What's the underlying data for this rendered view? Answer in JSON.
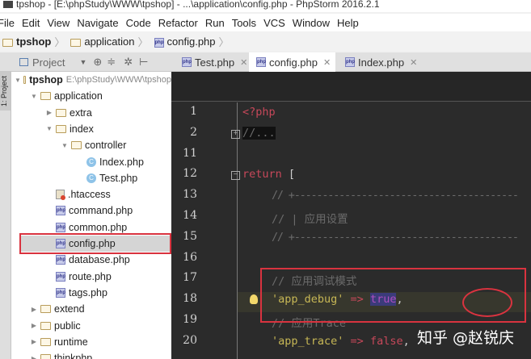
{
  "title": "tpshop - [E:\\phpStudy\\WWW\\tpshop] - ...\\application\\config.php - PhpStorm 2016.2.1",
  "menu": [
    "File",
    "Edit",
    "View",
    "Navigate",
    "Code",
    "Refactor",
    "Run",
    "Tools",
    "VCS",
    "Window",
    "Help"
  ],
  "breadcrumb": [
    "tpshop",
    "application",
    "config.php"
  ],
  "project_panel": {
    "label": "Project",
    "strip_label": "1: Project"
  },
  "tabs": [
    {
      "label": "Test.php"
    },
    {
      "label": "config.php",
      "active": true
    },
    {
      "label": "Index.php"
    }
  ],
  "tree": [
    {
      "label": "tpshop",
      "path": "E:\\phpStudy\\WWW\\tpshop",
      "icon": "folder",
      "depth": 0,
      "expanded": true
    },
    {
      "label": "application",
      "icon": "folder",
      "depth": 1,
      "expanded": true
    },
    {
      "label": "extra",
      "icon": "folder",
      "depth": 2,
      "expanded": false
    },
    {
      "label": "index",
      "icon": "folder",
      "depth": 2,
      "expanded": true
    },
    {
      "label": "controller",
      "icon": "folder",
      "depth": 3,
      "expanded": true
    },
    {
      "label": "Index.php",
      "icon": "class",
      "depth": 4
    },
    {
      "label": "Test.php",
      "icon": "class",
      "depth": 4
    },
    {
      "label": ".htaccess",
      "icon": "htaccess",
      "depth": 2
    },
    {
      "label": "command.php",
      "icon": "php",
      "depth": 2
    },
    {
      "label": "common.php",
      "icon": "php",
      "depth": 2
    },
    {
      "label": "config.php",
      "icon": "php",
      "depth": 2,
      "selected": true
    },
    {
      "label": "database.php",
      "icon": "php",
      "depth": 2
    },
    {
      "label": "route.php",
      "icon": "php",
      "depth": 2
    },
    {
      "label": "tags.php",
      "icon": "php",
      "depth": 2
    },
    {
      "label": "extend",
      "icon": "folder",
      "depth": 1,
      "expanded": false
    },
    {
      "label": "public",
      "icon": "folder",
      "depth": 1,
      "expanded": false
    },
    {
      "label": "runtime",
      "icon": "folder",
      "depth": 1,
      "expanded": false
    },
    {
      "label": "thinkphp",
      "icon": "folder",
      "depth": 1,
      "expanded": false
    }
  ],
  "code": [
    {
      "n": "1",
      "parts": [
        [
          "kw",
          "<?php"
        ]
      ]
    },
    {
      "n": "2",
      "parts": [
        [
          "cm",
          "//..."
        ]
      ],
      "fold": "plus"
    },
    {
      "n": "11",
      "parts": []
    },
    {
      "n": "12",
      "parts": [
        [
          "kw",
          "return"
        ],
        [
          "",
          "  ["
        ]
      ],
      "fold": "minus"
    },
    {
      "n": "13",
      "parts": [
        [
          "cm",
          "// +----------------------------------------"
        ]
      ],
      "indent": true
    },
    {
      "n": "14",
      "parts": [
        [
          "cm",
          "// | 应用设置"
        ]
      ],
      "indent": true
    },
    {
      "n": "15",
      "parts": [
        [
          "cm",
          "// +----------------------------------------"
        ]
      ],
      "indent": true
    },
    {
      "n": "16",
      "parts": []
    },
    {
      "n": "17",
      "parts": [
        [
          "cm",
          "// 应用调试模式"
        ]
      ],
      "indent": true
    },
    {
      "n": "18",
      "parts": [
        [
          "str",
          "'app_debug'"
        ],
        [
          "",
          "             "
        ],
        [
          "op",
          "=>"
        ],
        [
          "",
          " "
        ],
        [
          "tr",
          "true"
        ],
        [
          "",
          ","
        ]
      ],
      "indent": true
    },
    {
      "n": "19",
      "parts": [
        [
          "cm",
          "// 应用Trace"
        ]
      ],
      "indent": true
    },
    {
      "n": "20",
      "parts": [
        [
          "str",
          "'app_trace'"
        ],
        [
          "",
          "             "
        ],
        [
          "op",
          "=>"
        ],
        [
          "",
          " "
        ],
        [
          "kw",
          "false"
        ],
        [
          "",
          ","
        ]
      ],
      "indent": true
    }
  ],
  "watermark": "知乎 @赵锐庆"
}
